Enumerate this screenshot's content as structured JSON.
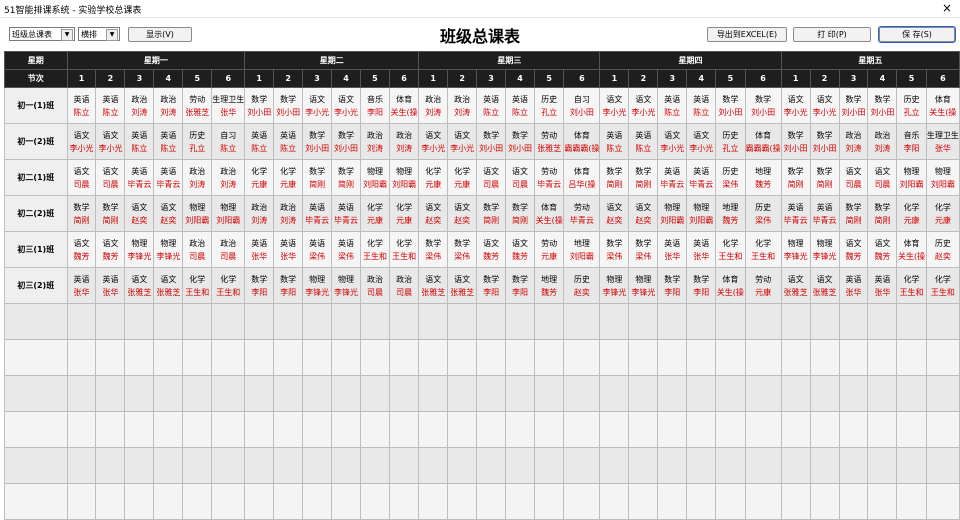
{
  "window": {
    "title": "51智能排课系统 - 实验学校总课表",
    "close": "×"
  },
  "toolbar": {
    "view_select": "班级总课表",
    "layout_select": "横排",
    "show_button": "显示(V)",
    "export_button": "导出到EXCEL(E)",
    "print_button": "打 印(P)",
    "save_button": "保 存(S)"
  },
  "page_title": "班级总课表",
  "header": {
    "week_label": "星期",
    "period_label": "节次",
    "days": [
      "星期一",
      "星期二",
      "星期三",
      "星期四",
      "星期五"
    ],
    "periods": [
      "1",
      "2",
      "3",
      "4",
      "5",
      "6"
    ]
  },
  "classes": [
    {
      "name": "初一(1)班",
      "days": [
        [
          [
            "英语",
            "陈立"
          ],
          [
            "英语",
            "陈立"
          ],
          [
            "政治",
            "刘涛"
          ],
          [
            "政治",
            "刘涛"
          ],
          [
            "劳动",
            "张雅芝"
          ],
          [
            "生理卫生",
            "张华"
          ]
        ],
        [
          [
            "数学",
            "刘小田"
          ],
          [
            "数学",
            "刘小田"
          ],
          [
            "语文",
            "李小光"
          ],
          [
            "语文",
            "李小光"
          ],
          [
            "音乐",
            "李阳"
          ],
          [
            "体育",
            "关生(操"
          ]
        ],
        [
          [
            "政治",
            "刘涛"
          ],
          [
            "政治",
            "刘涛"
          ],
          [
            "英语",
            "陈立"
          ],
          [
            "英语",
            "陈立"
          ],
          [
            "历史",
            "孔立"
          ],
          [
            "自习",
            "刘小田"
          ]
        ],
        [
          [
            "语文",
            "李小光"
          ],
          [
            "语文",
            "李小光"
          ],
          [
            "英语",
            "陈立"
          ],
          [
            "英语",
            "陈立"
          ],
          [
            "数学",
            "刘小田"
          ],
          [
            "数学",
            "刘小田"
          ]
        ],
        [
          [
            "语文",
            "李小光"
          ],
          [
            "语文",
            "李小光"
          ],
          [
            "数学",
            "刘小田"
          ],
          [
            "数学",
            "刘小田"
          ],
          [
            "历史",
            "孔立"
          ],
          [
            "体育",
            "关生(操"
          ]
        ]
      ]
    },
    {
      "name": "初一(2)班",
      "days": [
        [
          [
            "语文",
            "李小光"
          ],
          [
            "语文",
            "李小光"
          ],
          [
            "英语",
            "陈立"
          ],
          [
            "英语",
            "陈立"
          ],
          [
            "历史",
            "孔立"
          ],
          [
            "自习",
            "陈立"
          ]
        ],
        [
          [
            "英语",
            "陈立"
          ],
          [
            "英语",
            "陈立"
          ],
          [
            "数学",
            "刘小田"
          ],
          [
            "数学",
            "刘小田"
          ],
          [
            "政治",
            "刘涛"
          ],
          [
            "政治",
            "刘涛"
          ]
        ],
        [
          [
            "语文",
            "李小光"
          ],
          [
            "语文",
            "李小光"
          ],
          [
            "数学",
            "刘小田"
          ],
          [
            "数学",
            "刘小田"
          ],
          [
            "劳动",
            "张雅芝"
          ],
          [
            "体育",
            "霸霸霸(操"
          ]
        ],
        [
          [
            "英语",
            "陈立"
          ],
          [
            "英语",
            "陈立"
          ],
          [
            "语文",
            "李小光"
          ],
          [
            "语文",
            "李小光"
          ],
          [
            "历史",
            "孔立"
          ],
          [
            "体育",
            "霸霸霸(操"
          ]
        ],
        [
          [
            "数学",
            "刘小田"
          ],
          [
            "数学",
            "刘小田"
          ],
          [
            "政治",
            "刘涛"
          ],
          [
            "政治",
            "刘涛"
          ],
          [
            "音乐",
            "李阳"
          ],
          [
            "生理卫生",
            "张华"
          ]
        ]
      ]
    },
    {
      "name": "初二(1)班",
      "days": [
        [
          [
            "语文",
            "司晨"
          ],
          [
            "语文",
            "司晨"
          ],
          [
            "英语",
            "毕青云"
          ],
          [
            "英语",
            "毕青云"
          ],
          [
            "政治",
            "刘涛"
          ],
          [
            "政治",
            "刘涛"
          ]
        ],
        [
          [
            "化学",
            "元康"
          ],
          [
            "化学",
            "元康"
          ],
          [
            "数学",
            "简刚"
          ],
          [
            "数学",
            "简刚"
          ],
          [
            "物理",
            "刘阳霸"
          ],
          [
            "物理",
            "刘阳霸"
          ]
        ],
        [
          [
            "化学",
            "元康"
          ],
          [
            "化学",
            "元康"
          ],
          [
            "语文",
            "司晨"
          ],
          [
            "语文",
            "司晨"
          ],
          [
            "劳动",
            "毕青云"
          ],
          [
            "体育",
            "吕华(操"
          ]
        ],
        [
          [
            "数学",
            "简刚"
          ],
          [
            "数学",
            "简刚"
          ],
          [
            "英语",
            "毕青云"
          ],
          [
            "英语",
            "毕青云"
          ],
          [
            "历史",
            "梁伟"
          ],
          [
            "地理",
            "魏芳"
          ]
        ],
        [
          [
            "数学",
            "简刚"
          ],
          [
            "数学",
            "简刚"
          ],
          [
            "语文",
            "司晨"
          ],
          [
            "语文",
            "司晨"
          ],
          [
            "物理",
            "刘阳霸"
          ],
          [
            "物理",
            "刘阳霸"
          ]
        ]
      ]
    },
    {
      "name": "初二(2)班",
      "days": [
        [
          [
            "数学",
            "简刚"
          ],
          [
            "数学",
            "简刚"
          ],
          [
            "语文",
            "赵奕"
          ],
          [
            "语文",
            "赵奕"
          ],
          [
            "物理",
            "刘阳霸"
          ],
          [
            "物理",
            "刘阳霸"
          ]
        ],
        [
          [
            "政治",
            "刘涛"
          ],
          [
            "政治",
            "刘涛"
          ],
          [
            "英语",
            "毕青云"
          ],
          [
            "英语",
            "毕青云"
          ],
          [
            "化学",
            "元康"
          ],
          [
            "化学",
            "元康"
          ]
        ],
        [
          [
            "语文",
            "赵奕"
          ],
          [
            "语文",
            "赵奕"
          ],
          [
            "数学",
            "简刚"
          ],
          [
            "数学",
            "简刚"
          ],
          [
            "体育",
            "关生(操"
          ],
          [
            "劳动",
            "毕青云"
          ]
        ],
        [
          [
            "语文",
            "赵奕"
          ],
          [
            "语文",
            "赵奕"
          ],
          [
            "物理",
            "刘阳霸"
          ],
          [
            "物理",
            "刘阳霸"
          ],
          [
            "地理",
            "魏芳"
          ],
          [
            "历史",
            "梁伟"
          ]
        ],
        [
          [
            "英语",
            "毕青云"
          ],
          [
            "英语",
            "毕青云"
          ],
          [
            "数学",
            "简刚"
          ],
          [
            "数学",
            "简刚"
          ],
          [
            "化学",
            "元康"
          ],
          [
            "化学",
            "元康"
          ]
        ]
      ]
    },
    {
      "name": "初三(1)班",
      "days": [
        [
          [
            "语文",
            "魏芳"
          ],
          [
            "语文",
            "魏芳"
          ],
          [
            "物理",
            "李锋光"
          ],
          [
            "物理",
            "李锋光"
          ],
          [
            "政治",
            "司晨"
          ],
          [
            "政治",
            "司晨"
          ]
        ],
        [
          [
            "英语",
            "张华"
          ],
          [
            "英语",
            "张华"
          ],
          [
            "英语",
            "梁伟"
          ],
          [
            "英语",
            "梁伟"
          ],
          [
            "化学",
            "王生和"
          ],
          [
            "化学",
            "王生和"
          ]
        ],
        [
          [
            "数学",
            "梁伟"
          ],
          [
            "数学",
            "梁伟"
          ],
          [
            "语文",
            "魏芳"
          ],
          [
            "语文",
            "魏芳"
          ],
          [
            "劳动",
            "元康"
          ],
          [
            "地理",
            "刘阳霸"
          ]
        ],
        [
          [
            "数学",
            "梁伟"
          ],
          [
            "数学",
            "梁伟"
          ],
          [
            "英语",
            "张华"
          ],
          [
            "英语",
            "张华"
          ],
          [
            "化学",
            "王生和"
          ],
          [
            "化学",
            "王生和"
          ]
        ],
        [
          [
            "物理",
            "李锋光"
          ],
          [
            "物理",
            "李锋光"
          ],
          [
            "语文",
            "魏芳"
          ],
          [
            "语文",
            "魏芳"
          ],
          [
            "体育",
            "关生(操"
          ],
          [
            "历史",
            "赵奕"
          ]
        ]
      ]
    },
    {
      "name": "初三(2)班",
      "days": [
        [
          [
            "英语",
            "张华"
          ],
          [
            "英语",
            "张华"
          ],
          [
            "语文",
            "张雅芝"
          ],
          [
            "语文",
            "张雅芝"
          ],
          [
            "化学",
            "王生和"
          ],
          [
            "化学",
            "王生和"
          ]
        ],
        [
          [
            "数学",
            "李阳"
          ],
          [
            "数学",
            "李阳"
          ],
          [
            "物理",
            "李锋光"
          ],
          [
            "物理",
            "李锋光"
          ],
          [
            "政治",
            "司晨"
          ],
          [
            "政治",
            "司晨"
          ]
        ],
        [
          [
            "语文",
            "张雅芝"
          ],
          [
            "语文",
            "张雅芝"
          ],
          [
            "数学",
            "李阳"
          ],
          [
            "数学",
            "李阳"
          ],
          [
            "地理",
            "魏芳"
          ],
          [
            "历史",
            "赵奕"
          ]
        ],
        [
          [
            "物理",
            "李锋光"
          ],
          [
            "物理",
            "李锋光"
          ],
          [
            "数学",
            "李阳"
          ],
          [
            "数学",
            "李阳"
          ],
          [
            "体育",
            "关生(操"
          ],
          [
            "劳动",
            "元康"
          ]
        ],
        [
          [
            "语文",
            "张雅芝"
          ],
          [
            "语文",
            "张雅芝"
          ],
          [
            "英语",
            "张华"
          ],
          [
            "英语",
            "张华"
          ],
          [
            "化学",
            "王生和"
          ],
          [
            "化学",
            "王生和"
          ]
        ]
      ]
    }
  ]
}
